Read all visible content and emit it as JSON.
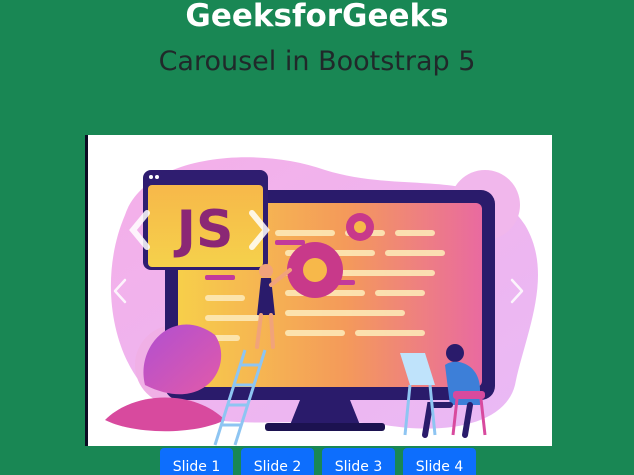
{
  "header": {
    "title": "GeeksforGeeks",
    "subtitle": "Carousel in Bootstrap 5"
  },
  "carousel": {
    "image_badge": "JS",
    "prev_icon": "chevron-left-icon",
    "next_icon": "chevron-right-icon"
  },
  "slide_buttons": [
    {
      "label": "Slide 1"
    },
    {
      "label": "Slide 2"
    },
    {
      "label": "Slide 3"
    },
    {
      "label": "Slide 4"
    }
  ],
  "colors": {
    "page_background": "#198754",
    "title": "#ffffff",
    "subtitle": "#20292a",
    "button": "#0d6efd"
  }
}
